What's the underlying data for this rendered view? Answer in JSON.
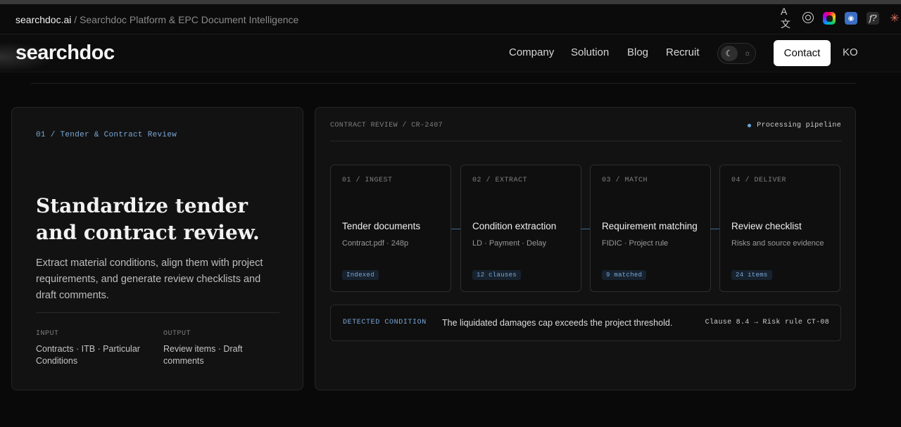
{
  "browser": {
    "domain": "searchdoc.ai",
    "separator": " / ",
    "page_title": "Searchdoc Platform & EPC Document Intelligence",
    "extensions": [
      "translate-icon",
      "openai-icon",
      "color-picker-icon",
      "blue-extension-icon",
      "font-icon",
      "claude-icon"
    ]
  },
  "header": {
    "logo": "searchdoc",
    "nav": {
      "company": "Company",
      "solution": "Solution",
      "blog": "Blog",
      "recruit": "Recruit"
    },
    "contact": "Contact",
    "language": "KO"
  },
  "left_card": {
    "eyebrow": "01 / Tender & Contract Review",
    "headline": "Standardize tender and contract review.",
    "description": "Extract material conditions, align them with project requirements, and generate review checklists and draft comments.",
    "input_label": "INPUT",
    "input_value": "Contracts · ITB · Particular Conditions",
    "output_label": "OUTPUT",
    "output_value": "Review items · Draft comments"
  },
  "right_card": {
    "breadcrumb": "CONTRACT REVIEW / CR-2407",
    "status": "Processing pipeline",
    "stages": [
      {
        "label": "01 / INGEST",
        "title": "Tender documents",
        "sub": "Contract.pdf · 248p",
        "badge": "Indexed"
      },
      {
        "label": "02 / EXTRACT",
        "title": "Condition extraction",
        "sub": "LD · Payment · Delay",
        "badge": "12 clauses"
      },
      {
        "label": "03 / MATCH",
        "title": "Requirement matching",
        "sub": "FIDIC · Project rule",
        "badge": "9 matched"
      },
      {
        "label": "04 / DELIVER",
        "title": "Review checklist",
        "sub": "Risks and source evidence",
        "badge": "24 items"
      }
    ],
    "detected": {
      "label": "DETECTED CONDITION",
      "text": "The liquidated damages cap exceeds the project threshold.",
      "reference": "Clause 8.4 → Risk rule CT-08"
    }
  },
  "colors": {
    "accent": "#7aa7d8",
    "background": "#090909",
    "card": "#121212"
  }
}
